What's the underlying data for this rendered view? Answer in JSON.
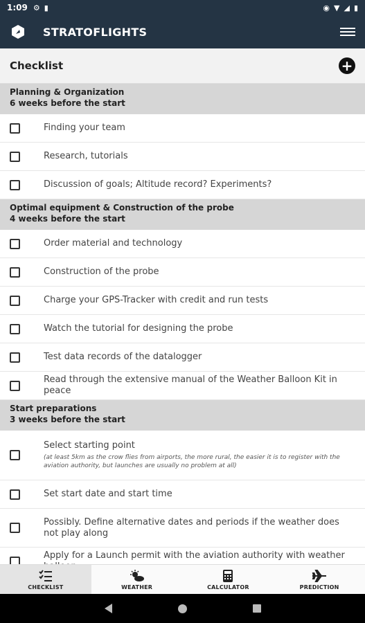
{
  "status": {
    "time": "1:09"
  },
  "app": {
    "title": "STRATOFLIGHTS"
  },
  "header": {
    "title": "Checklist"
  },
  "sections": [
    {
      "title": "Planning & Organization",
      "subtitle": "6 weeks before the start",
      "items": [
        "Finding your team",
        "Research, tutorials",
        "Discussion of goals; Altitude record? Experiments?"
      ]
    },
    {
      "title": "Optimal equipment & Construction of the probe",
      "subtitle": "4 weeks before the start",
      "items": [
        "Order material and technology",
        "Construction of the probe",
        "Charge your GPS-Tracker with credit and run tests",
        "Watch the tutorial for designing the probe",
        "Test data records of the datalogger",
        "Read through the extensive manual of the Weather Balloon Kit in peace"
      ]
    },
    {
      "title": "Start preparations",
      "subtitle": "3 weeks before the start",
      "item0": "Select starting point",
      "item0_note": "(at least 5km as the crow flies from airports, the more rural, the easier it is to register with the aviation authority, but launches are usually no problem at all)",
      "item1": "Set start date and start time",
      "item2": "Possibly. Define alternative dates and periods if the weather does not play along",
      "item3": "Apply for a Launch permit with the aviation authority with weather balloon"
    }
  ],
  "nav": {
    "checklist": "CHECKLIST",
    "weather": "WEATHER",
    "calculator": "CALCULATOR",
    "prediction": "PREDICTION"
  }
}
